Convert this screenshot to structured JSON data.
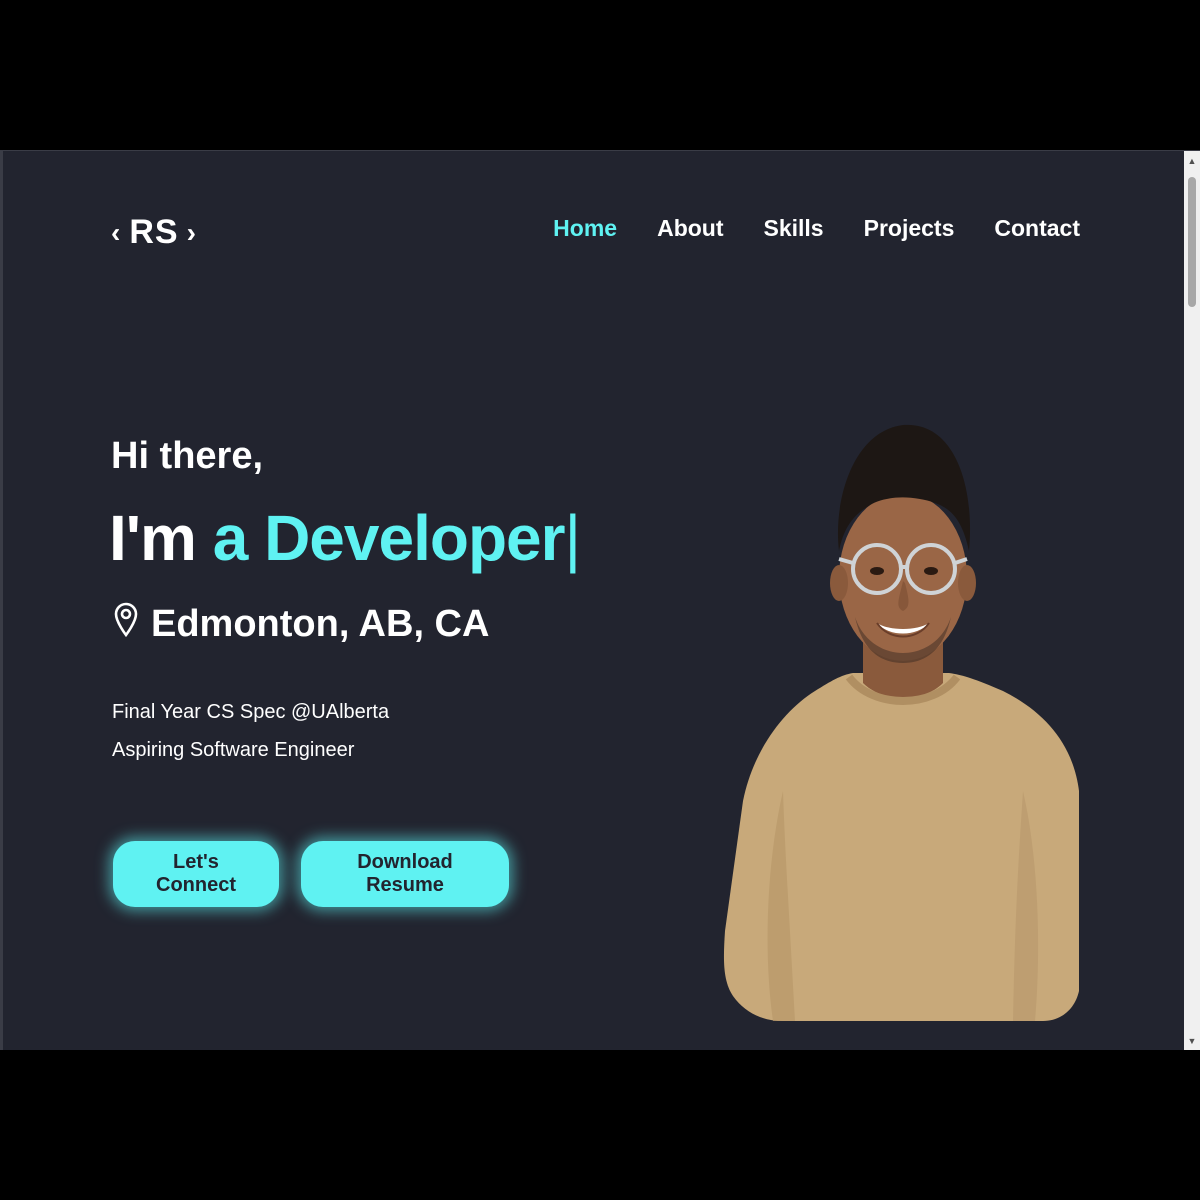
{
  "logo": {
    "left_bracket": "‹",
    "initials": "RS",
    "right_bracket": "›"
  },
  "nav": {
    "items": [
      {
        "label": "Home",
        "active": true
      },
      {
        "label": "About",
        "active": false
      },
      {
        "label": "Skills",
        "active": false
      },
      {
        "label": "Projects",
        "active": false
      },
      {
        "label": "Contact",
        "active": false
      }
    ]
  },
  "hero": {
    "greeting": "Hi there,",
    "title_prefix": "I'm ",
    "title_accent": "a Developer",
    "title_cursor": "|",
    "location": "Edmonton, AB, CA",
    "description_line1": "Final Year CS Spec @UAlberta",
    "description_line2": "Aspiring Software Engineer"
  },
  "buttons": {
    "connect_label": "Let's Connect",
    "resume_label": "Download Resume"
  },
  "icons": {
    "location": "location-pin-icon",
    "scroll_up": "chevron-up-icon",
    "scroll_down": "chevron-down-icon"
  },
  "colors": {
    "background": "#22242f",
    "accent": "#5ff2f2",
    "text": "#ffffff",
    "shirt": "#c8a97a"
  }
}
